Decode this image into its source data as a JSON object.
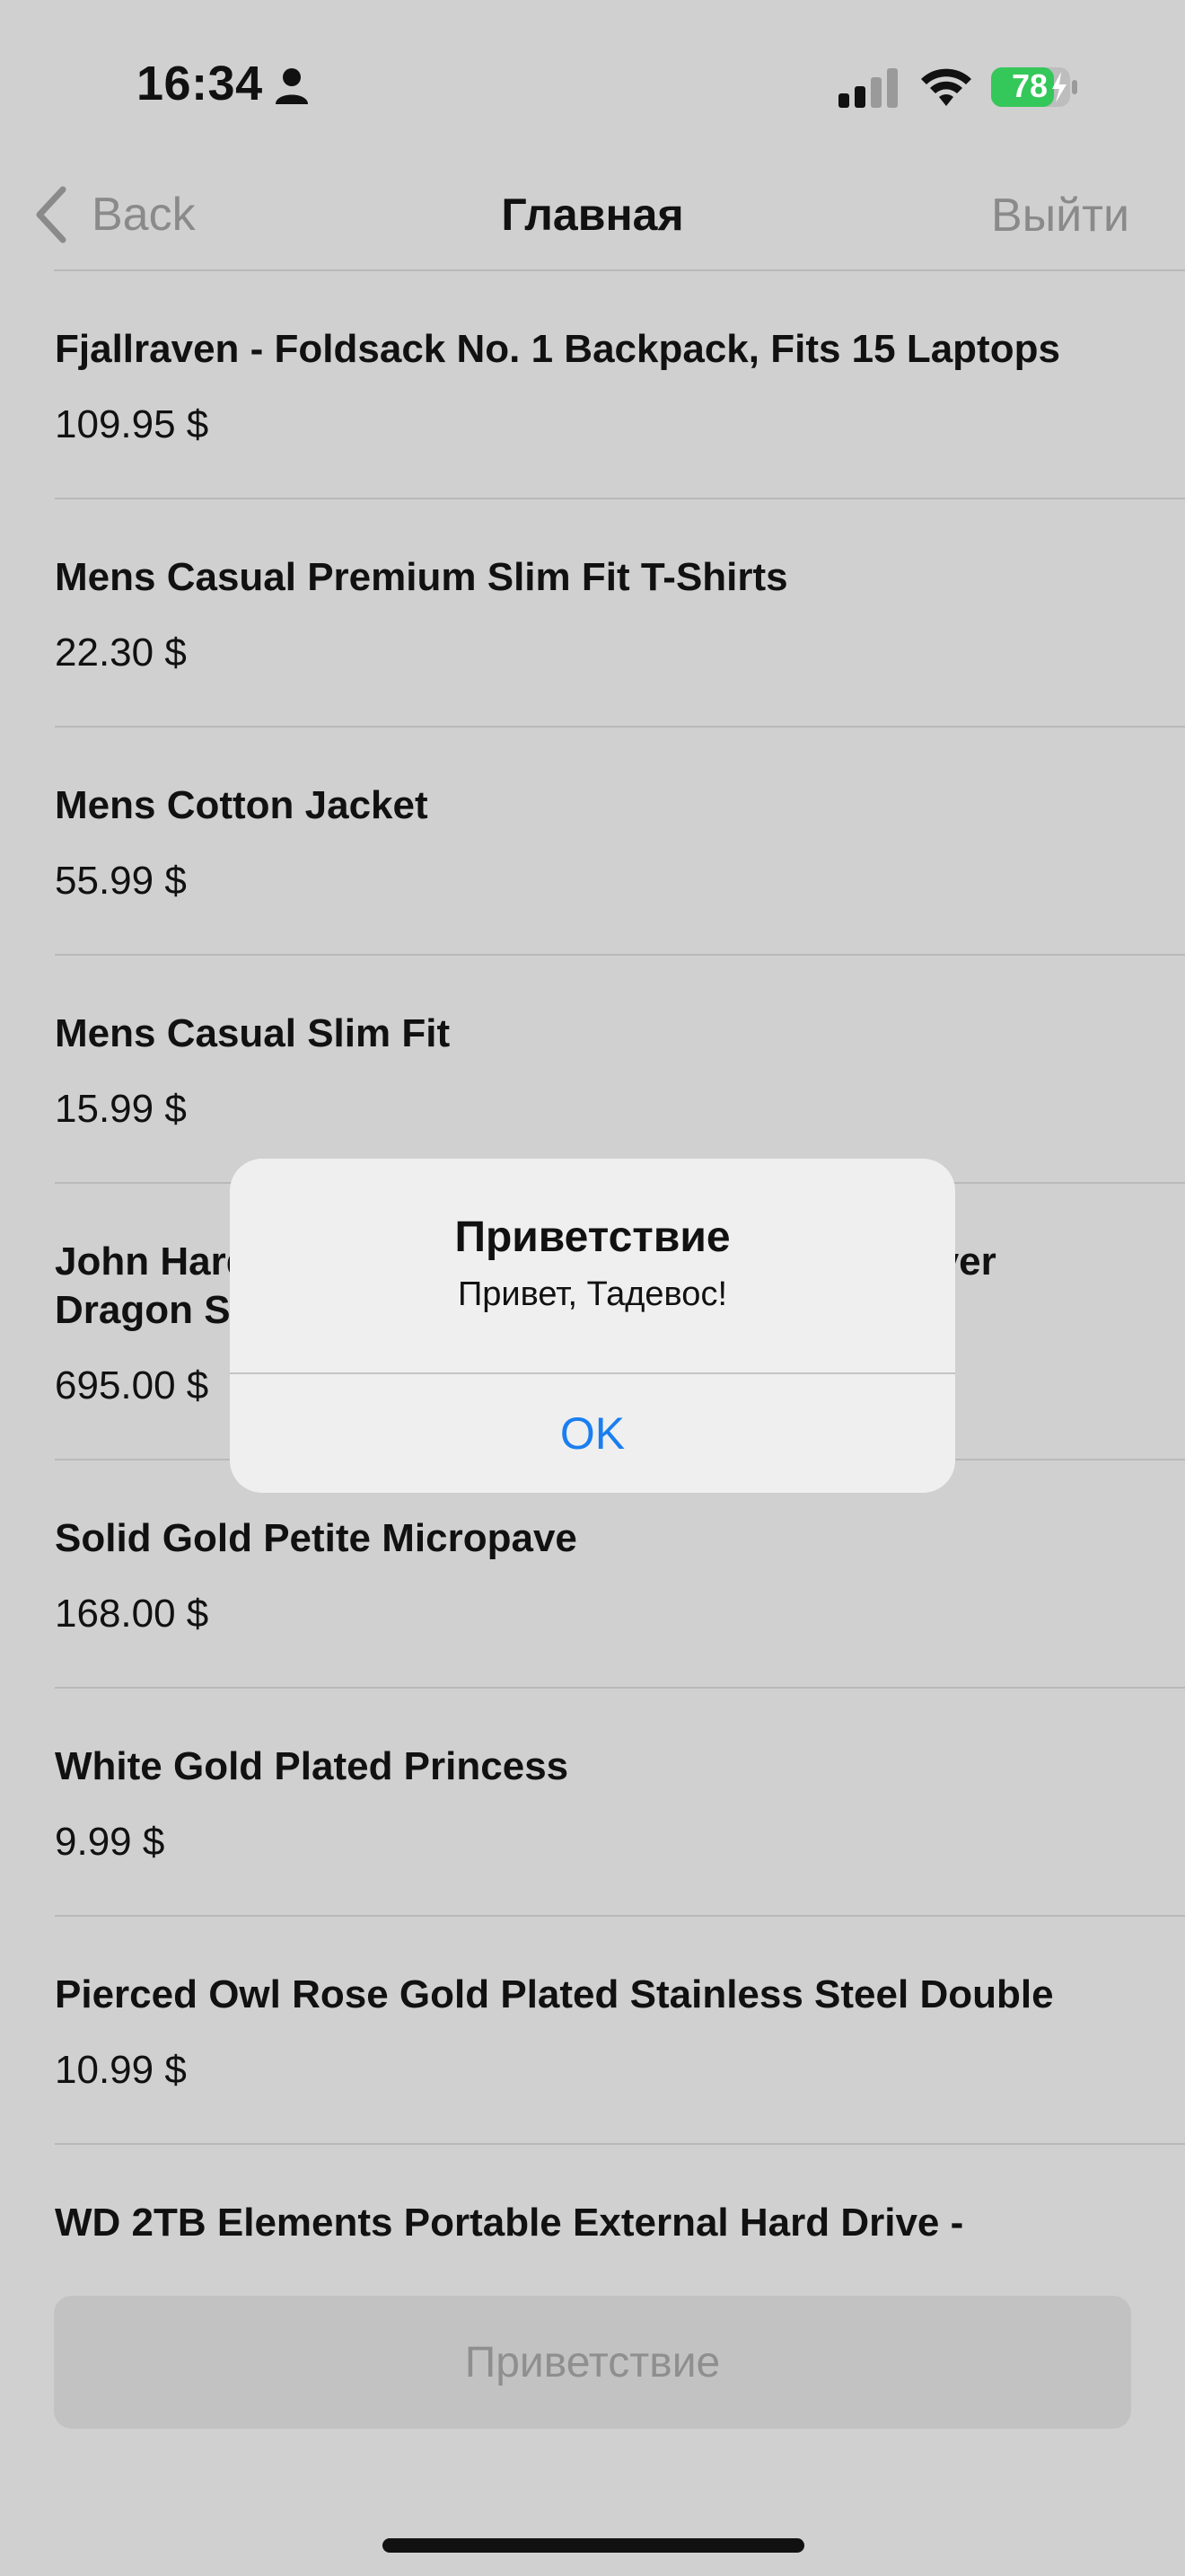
{
  "status_bar": {
    "time": "16:34",
    "battery_level": "78",
    "battery_color": "#34c759",
    "icons": [
      "person-icon",
      "signal-icon",
      "wifi-icon",
      "battery-charging-icon"
    ]
  },
  "nav": {
    "back_label": "Back",
    "title": "Главная",
    "logout_label": "Выйти"
  },
  "products": [
    {
      "title": "Fjallraven - Foldsack No. 1 Backpack, Fits 15 Laptops",
      "price": "109.95 $"
    },
    {
      "title": "Mens Casual Premium Slim Fit T-Shirts",
      "price": "22.30 $"
    },
    {
      "title": "Mens Cotton Jacket",
      "price": "55.99 $"
    },
    {
      "title": "Mens Casual Slim Fit",
      "price": "15.99 $"
    },
    {
      "title": "John Hardy Women's Legends Naga Gold & Silver Dragon Station Chain Bracelet",
      "price": "695.00 $"
    },
    {
      "title": "Solid Gold Petite Micropave",
      "price": "168.00 $"
    },
    {
      "title": "White Gold Plated Princess",
      "price": "9.99 $"
    },
    {
      "title": "Pierced Owl Rose Gold Plated Stainless Steel Double",
      "price": "10.99 $"
    },
    {
      "title": "WD 2TB Elements Portable External Hard Drive -",
      "price": ""
    }
  ],
  "bottom_button": {
    "label": "Приветствие"
  },
  "alert": {
    "title": "Приветствие",
    "message": "Привет, Тадевос!",
    "ok_label": "OK",
    "accent_color": "#1a7ef0"
  }
}
